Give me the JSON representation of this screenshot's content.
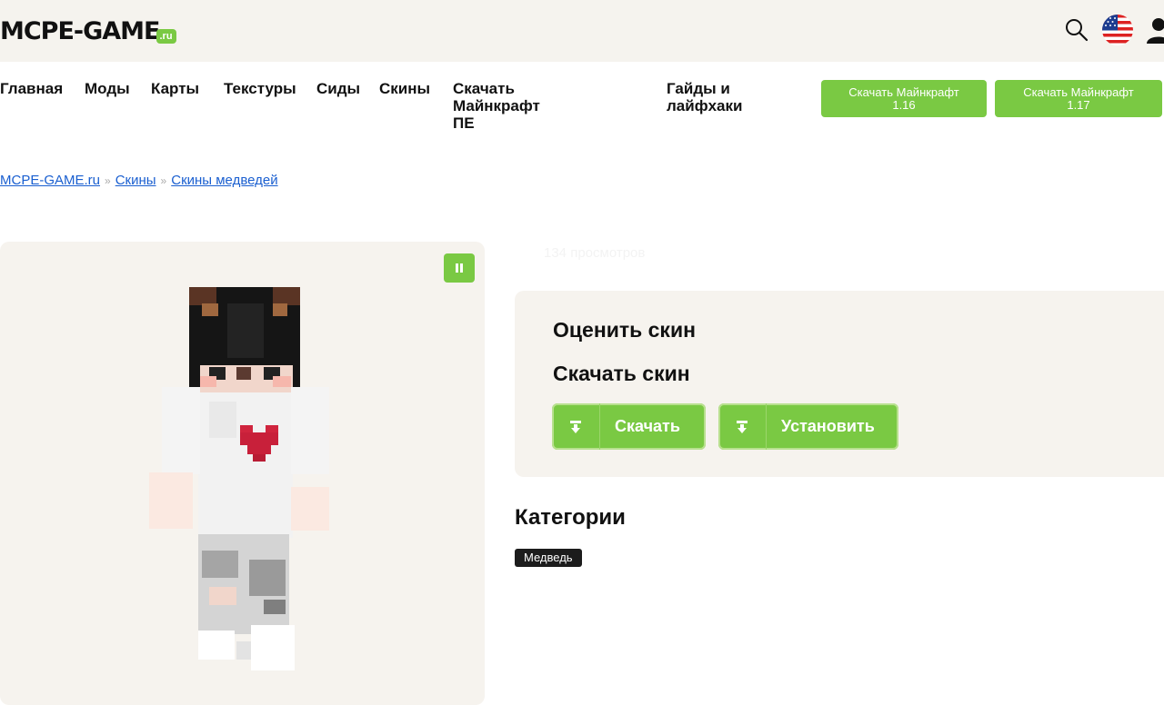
{
  "header": {
    "logo_main": "MCPE-GAME",
    "logo_suffix": ".ru",
    "colors": {
      "accent": "#7ac943",
      "topbar_bg": "#f5f3ee",
      "link": "#1a5fd0"
    }
  },
  "nav": {
    "items": [
      {
        "label": "Главная"
      },
      {
        "label": "Моды"
      },
      {
        "label": "Карты"
      },
      {
        "label": "Текстуры"
      },
      {
        "label": "Сиды"
      },
      {
        "label": "Скины"
      },
      {
        "label_line1": "Скачать Майнкрафт",
        "label_line2": "ПЕ"
      },
      {
        "label_line1": "Гайды и",
        "label_line2": "лайфхаки"
      }
    ],
    "buttons": [
      {
        "line1": "Скачать Майнкрафт",
        "line2": "1.16"
      },
      {
        "line1": "Скачать Майнкрафт",
        "line2": "1.17"
      }
    ]
  },
  "breadcrumb": {
    "items": [
      "MCPE-GAME.ru",
      "Скины",
      "Скины медведей"
    ],
    "separator": "»"
  },
  "skin": {
    "views": "134 просмотров",
    "rate_heading": "Оценить скин",
    "download_heading": "Скачать скин",
    "download_button": "Скачать",
    "install_button": "Установить",
    "categories_heading": "Категории",
    "category_tag": "Медведь"
  },
  "icons": [
    "search-icon",
    "us-flag-icon",
    "user-icon",
    "pause-icon",
    "download-icon"
  ]
}
